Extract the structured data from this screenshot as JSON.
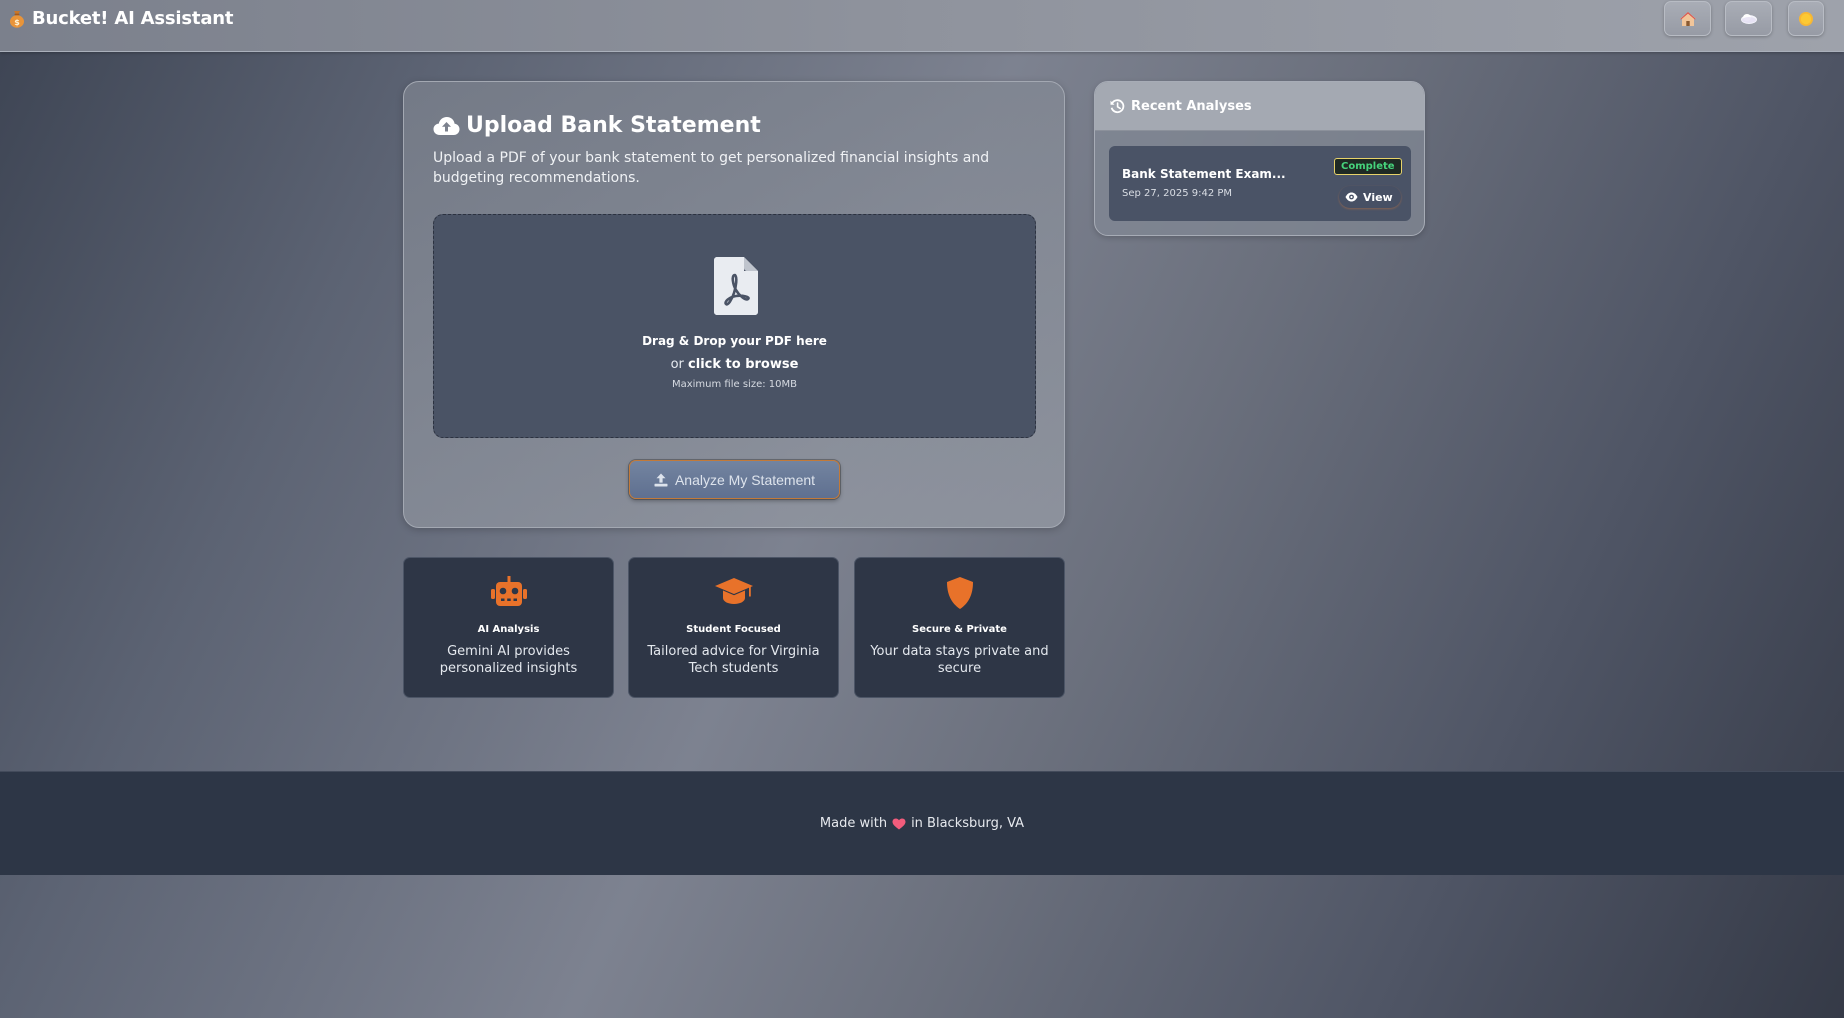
{
  "navbar": {
    "brand_icon": "money-bag-icon",
    "brand_title": "Bucket! AI Assistant",
    "buttons": [
      {
        "icon": "home-icon"
      },
      {
        "icon": "theme-toggle-icon"
      },
      {
        "icon": "sun-icon"
      }
    ]
  },
  "upload": {
    "icon": "cloud-upload-icon",
    "title": "Upload Bank Statement",
    "description": "Upload a PDF of your bank statement to get personalized financial insights and budgeting recommendations.",
    "dropzone": {
      "icon": "file-pdf-icon",
      "main": "Drag & Drop your PDF here",
      "or_prefix": "or",
      "browse": "click to browse",
      "max_size": "Maximum file size: 10MB"
    },
    "analyze_icon": "upload-icon",
    "analyze_label": "Analyze My Statement"
  },
  "features": [
    {
      "icon": "robot-icon",
      "title": "AI Analysis",
      "desc": "Gemini AI provides personalized insights"
    },
    {
      "icon": "graduation-cap-icon",
      "title": "Student Focused",
      "desc": "Tailored advice for Virginia Tech students"
    },
    {
      "icon": "shield-icon",
      "title": "Secure & Private",
      "desc": "Your data stays private and secure"
    }
  ],
  "recent": {
    "icon": "history-icon",
    "title": "Recent Analyses",
    "items": [
      {
        "title": "Bank Statement Exam...",
        "date": "Sep 27, 2025 9:42 PM",
        "status": "Complete",
        "view_label": "View"
      }
    ]
  },
  "footer": {
    "prefix": "Made with",
    "icon": "heart-icon",
    "suffix": "in Blacksburg, VA"
  },
  "colors": {
    "accent_orange": "#e8722a",
    "status_green": "#46d37c",
    "footer_bg": "#2d3646"
  }
}
